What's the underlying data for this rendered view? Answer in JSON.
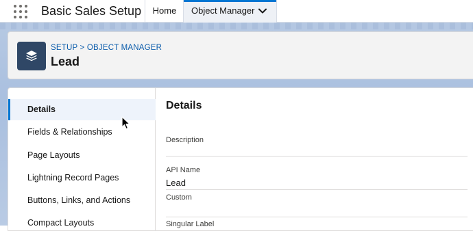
{
  "topbar": {
    "app_name": "Basic Sales Setup",
    "tabs": [
      {
        "label": "Home"
      },
      {
        "label": "Object Manager"
      }
    ]
  },
  "header": {
    "breadcrumb": {
      "part1": "SETUP",
      "separator": ">",
      "part2": "OBJECT MANAGER"
    },
    "title": "Lead",
    "icon": "layers-icon"
  },
  "sidebar": {
    "items": [
      {
        "label": "Details"
      },
      {
        "label": "Fields & Relationships"
      },
      {
        "label": "Page Layouts"
      },
      {
        "label": "Lightning Record Pages"
      },
      {
        "label": "Buttons, Links, and Actions"
      },
      {
        "label": "Compact Layouts"
      }
    ]
  },
  "details": {
    "title": "Details",
    "fields": [
      {
        "label": "Description",
        "value": ""
      },
      {
        "label": "API Name",
        "value": "Lead"
      },
      {
        "label": "Custom",
        "value": ""
      },
      {
        "label": "Singular Label",
        "value": ""
      }
    ]
  },
  "colors": {
    "accent": "#0176d3",
    "icon_bg": "#2f4766",
    "link": "#0b5cab"
  }
}
